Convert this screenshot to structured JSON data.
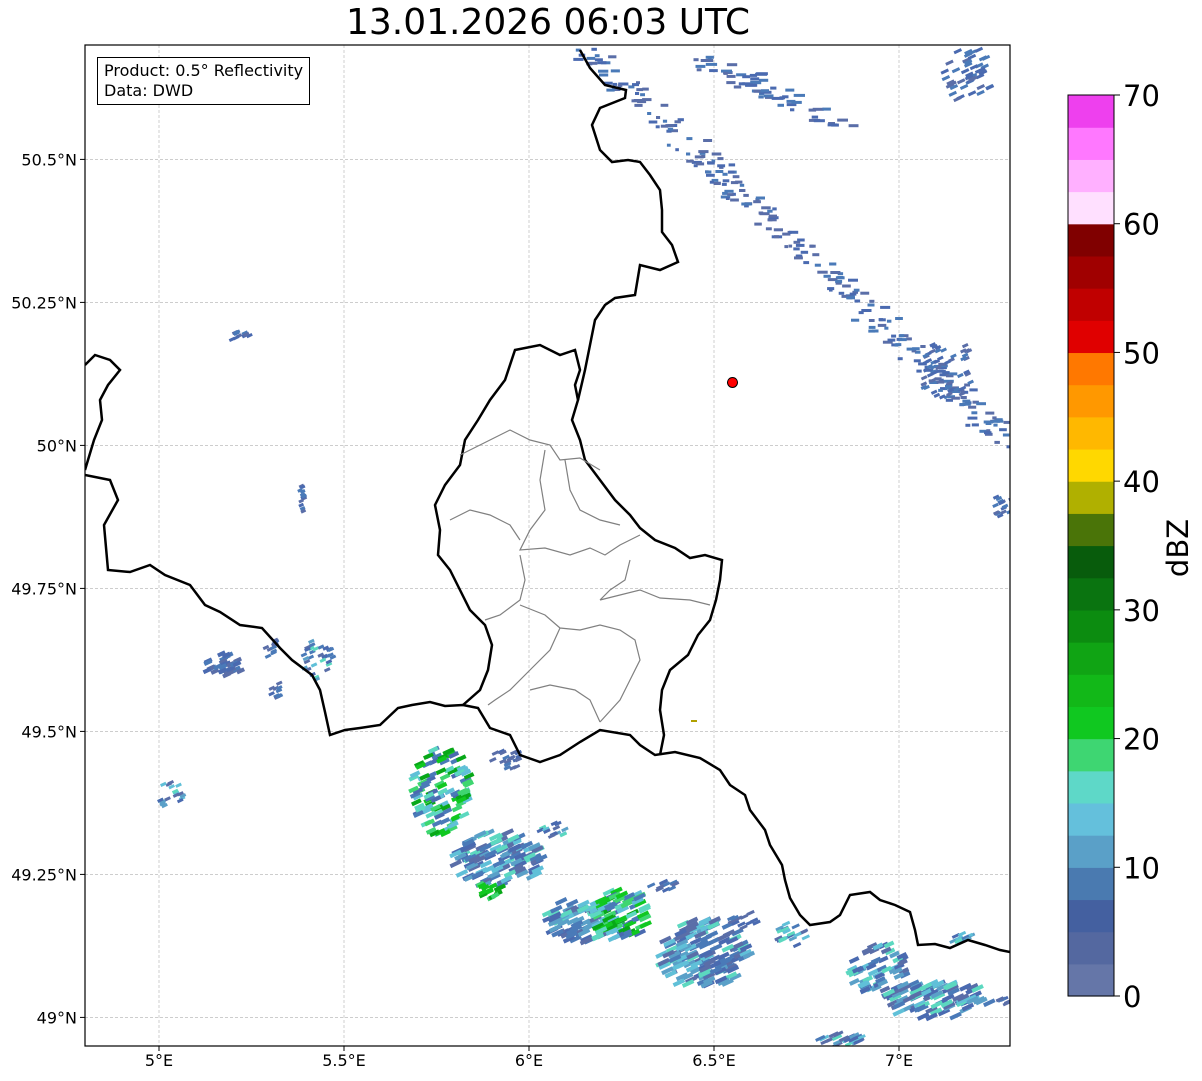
{
  "title": "13.01.2026 06:03 UTC",
  "info": {
    "product": "Product: 0.5° Reflectivity",
    "data": "Data: DWD"
  },
  "map": {
    "lon_range": [
      4.8,
      7.3
    ],
    "lat_range": [
      48.95,
      50.7
    ],
    "lon_ticks": [
      {
        "value": 5.0,
        "label": "5°E"
      },
      {
        "value": 5.5,
        "label": "5.5°E"
      },
      {
        "value": 6.0,
        "label": "6°E"
      },
      {
        "value": 6.5,
        "label": "6.5°E"
      },
      {
        "value": 7.0,
        "label": "7°E"
      }
    ],
    "lat_ticks": [
      {
        "value": 50.5,
        "label": "50.5°N"
      },
      {
        "value": 50.25,
        "label": "50.25°N"
      },
      {
        "value": 50.0,
        "label": "50°N"
      },
      {
        "value": 49.75,
        "label": "49.75°N"
      },
      {
        "value": 49.5,
        "label": "49.5°N"
      },
      {
        "value": 49.25,
        "label": "49.25°N"
      },
      {
        "value": 49.0,
        "label": "49°N"
      }
    ],
    "radar_site": {
      "lon": 6.55,
      "lat": 50.11,
      "color": "#ff0000"
    },
    "echo_colors": [
      "#5a6ea8",
      "#4a6ab0",
      "#4a7ab8",
      "#5aa0c8",
      "#60c0d8",
      "#5cd8c0",
      "#3ed670",
      "#10c820",
      "#08a818"
    ]
  },
  "colorbar": {
    "label": "dBZ",
    "ticks": [
      0,
      10,
      20,
      30,
      40,
      50,
      60,
      70
    ],
    "colors": [
      "#6576a8",
      "#5468a0",
      "#4460a0",
      "#4a7ab0",
      "#5aa0c8",
      "#64c0dc",
      "#5ed8c8",
      "#3ed672",
      "#10c820",
      "#12b818",
      "#10a414",
      "#0c8c10",
      "#0a7410",
      "#085c0c",
      "#4a7408",
      "#b0b000",
      "#ffd800",
      "#ffb800",
      "#ff9800",
      "#ff7800",
      "#e00000",
      "#c00000",
      "#a00000",
      "#800000",
      "#ffe0ff",
      "#ffb0ff",
      "#ff78ff",
      "#ee40ee"
    ]
  }
}
